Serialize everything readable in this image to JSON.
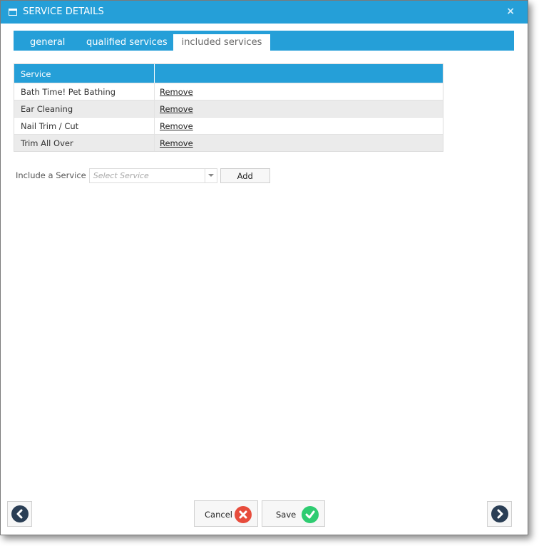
{
  "window": {
    "title": "SERVICE DETAILS",
    "close_label": "×"
  },
  "tabs": [
    {
      "label": "general",
      "active": false
    },
    {
      "label": "qualified services",
      "active": false
    },
    {
      "label": "included services",
      "active": true
    }
  ],
  "grid": {
    "columns": [
      "Service",
      ""
    ],
    "rows": [
      {
        "service": "Bath Time! Pet Bathing",
        "action": "Remove"
      },
      {
        "service": "Ear Cleaning",
        "action": "Remove"
      },
      {
        "service": "Nail Trim / Cut",
        "action": "Remove"
      },
      {
        "service": "Trim All Over",
        "action": "Remove"
      }
    ]
  },
  "include": {
    "label": "Include a Service",
    "select_placeholder": "Select Service",
    "add_label": "Add"
  },
  "footer": {
    "cancel_label": "Cancel",
    "save_label": "Save"
  },
  "colors": {
    "accent": "#259fd8",
    "cancel": "#e74c3c",
    "save": "#2ecc71",
    "nav": "#2a3e55"
  }
}
